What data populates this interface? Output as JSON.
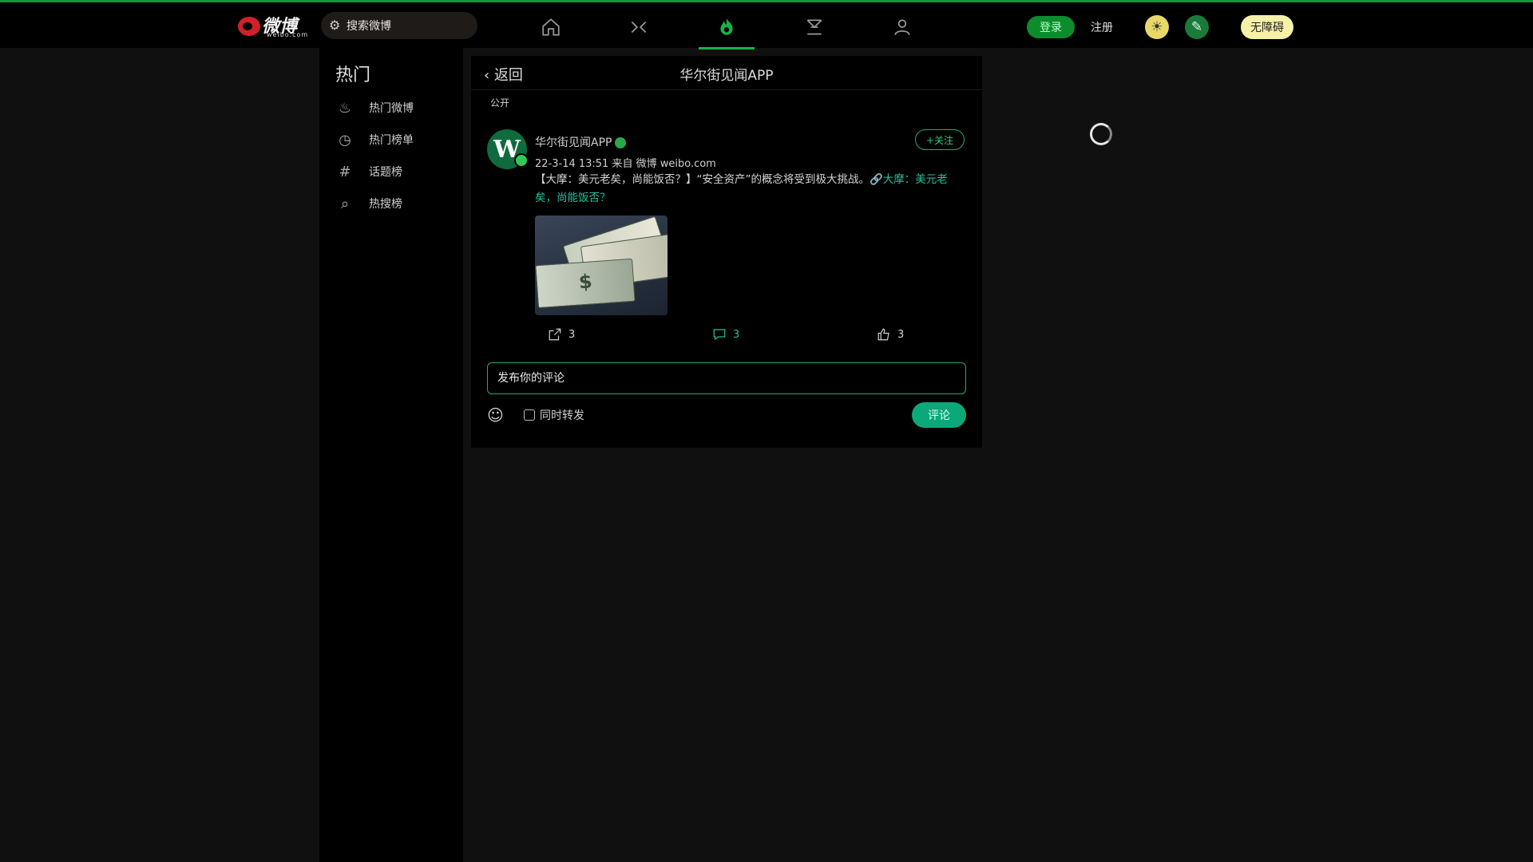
{
  "colors": {
    "accent": "#17b34a",
    "topline": "#0a9a3a",
    "background": "#101010",
    "panel": "#000000",
    "link": "#26c1a0"
  },
  "header": {
    "logo_text": "微博",
    "logo_sub": "weibo.com",
    "search_placeholder": "搜索微博",
    "nav": [
      {
        "icon": "home-icon"
      },
      {
        "icon": "video-icon"
      },
      {
        "icon": "hot-fire-icon",
        "active": true
      },
      {
        "icon": "message-icon"
      },
      {
        "icon": "profile-icon"
      }
    ],
    "login_label": "登录",
    "register_label": "注册",
    "theme_icon": "☀",
    "edit_icon": "✎",
    "no_access_label": "无障碍"
  },
  "sidebar": {
    "title": "热门",
    "items": [
      {
        "label": "热门微博",
        "icon": "fire-icon"
      },
      {
        "label": "热门榜单",
        "icon": "clock-icon"
      },
      {
        "label": "话题榜",
        "icon": "hashtag-icon"
      },
      {
        "label": "热搜榜",
        "icon": "search-icon"
      }
    ]
  },
  "post_page": {
    "back_label": "返回",
    "title": "华尔街见闻APP",
    "visibility": "公开",
    "author": "华尔街见闻APP",
    "avatar_letter": "W",
    "meta": "22-3-14 13:51 来自 微博 weibo.com",
    "follow_label": "+关注",
    "content_text": "【大摩：美元老矣，尚能饭否？】“安全资产”的概念将受到极大挑战。",
    "content_link": "🔗大摩：美元老矣，尚能饭否？",
    "stats": {
      "reposts": "3",
      "comments": "3",
      "likes": "3"
    },
    "comment_placeholder": "发布你的评论",
    "emoji_icon": "☺",
    "also_repost_label": "同时转发",
    "submit_label": "评论"
  }
}
